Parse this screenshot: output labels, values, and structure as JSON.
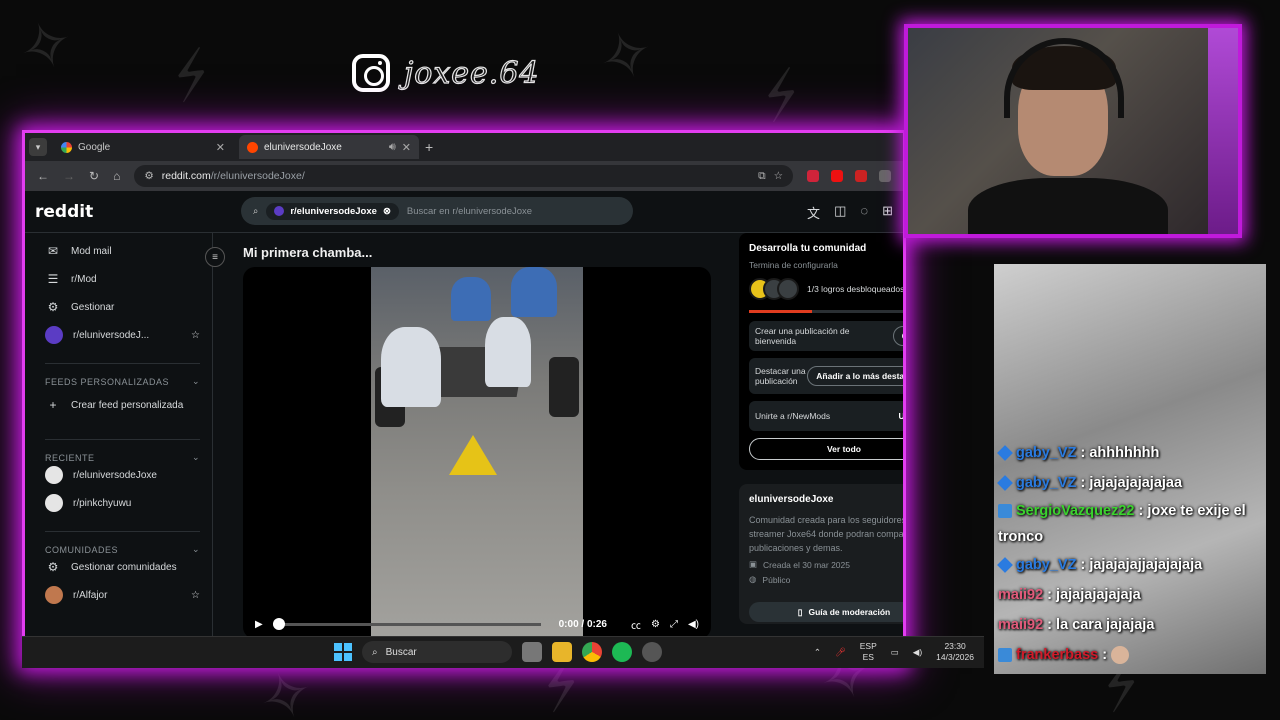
{
  "overlay": {
    "instagram_handle": "joxee.64"
  },
  "browser": {
    "tabs": [
      {
        "title": "Google",
        "active": false
      },
      {
        "title": "eluniversodeJoxe",
        "active": true
      }
    ],
    "url_host": "reddit.com",
    "url_path": "/r/eluniversodeJoxe/"
  },
  "reddit": {
    "logo": "reddit",
    "search_chip": "r/eluniversodeJoxe",
    "search_placeholder": "Buscar en r/eluniversodeJoxe",
    "sidebar": {
      "items": [
        {
          "label": "Mod mail",
          "icon": "mail-icon"
        },
        {
          "label": "r/Mod",
          "icon": "mod-queue-icon"
        },
        {
          "label": "Gestionar",
          "icon": "gear-icon"
        },
        {
          "label": "r/eluniversodeJ...",
          "icon": "community-avatar"
        }
      ],
      "feeds_heading": "FEEDS PERSONALIZADAS",
      "create_feed": "Crear feed personalizada",
      "recent_heading": "RECIENTE",
      "recent": [
        "r/eluniversodeJoxe",
        "r/pinkchyuwu"
      ],
      "communities_heading": "COMUNIDADES",
      "manage_communities": "Gestionar comunidades",
      "communities": [
        "r/Alfajor"
      ]
    },
    "post": {
      "title": "Mi primera chamba...",
      "video_time": "0:00 / 0:26",
      "progress": 0
    },
    "grow_card": {
      "title": "Desarrolla tu comunidad",
      "subtitle": "Termina de configurarla",
      "achievements": "1/3 logros desbloqueados",
      "progress": 0.33,
      "tasks": [
        {
          "label": "Crear una publicación de bienvenida",
          "button": "Crear"
        },
        {
          "label": "Destacar una publicación",
          "button": "Añadir a lo más destacado"
        },
        {
          "label": "Unirte a r/NewMods",
          "button": "Unirse"
        }
      ],
      "see_all": "Ver todo"
    },
    "about_card": {
      "name": "eluniversodeJoxe",
      "description": "Comunidad creada para los seguidores del streamer Joxe64 donde podran compartir sus publicaciones y demas.",
      "created": "Creada el 30 mar 2025",
      "visibility": "Público",
      "guide_button": "Guía de moderación"
    }
  },
  "taskbar": {
    "search": "Buscar",
    "lang_top": "ESP",
    "lang_bottom": "ES",
    "time": "23:30",
    "date": "14/3/2026"
  },
  "chat": {
    "messages": [
      {
        "user": "gaby_VZ",
        "text": "ahhhhhhh",
        "color": "#2a7be0"
      },
      {
        "user": "gaby_VZ",
        "text": "jajajajajajajaa",
        "color": "#2a7be0"
      },
      {
        "user": "SergioVazquez22",
        "text": "joxe te exije el tronco",
        "color": "#3bd32e"
      },
      {
        "user": "gaby_VZ",
        "text": "jajajajajjajajajaja",
        "color": "#2a7be0"
      },
      {
        "user": "maii92",
        "text": "jajajajajajaja",
        "color": "#e05a7a"
      },
      {
        "user": "maii92",
        "text": "la cara jajajaja",
        "color": "#e05a7a"
      },
      {
        "user": "frankerbass",
        "text": "",
        "color": "#d01b2a"
      }
    ]
  },
  "colors": {
    "accent_magenta": "#e23df0",
    "reddit_orange": "#e03c1f"
  }
}
